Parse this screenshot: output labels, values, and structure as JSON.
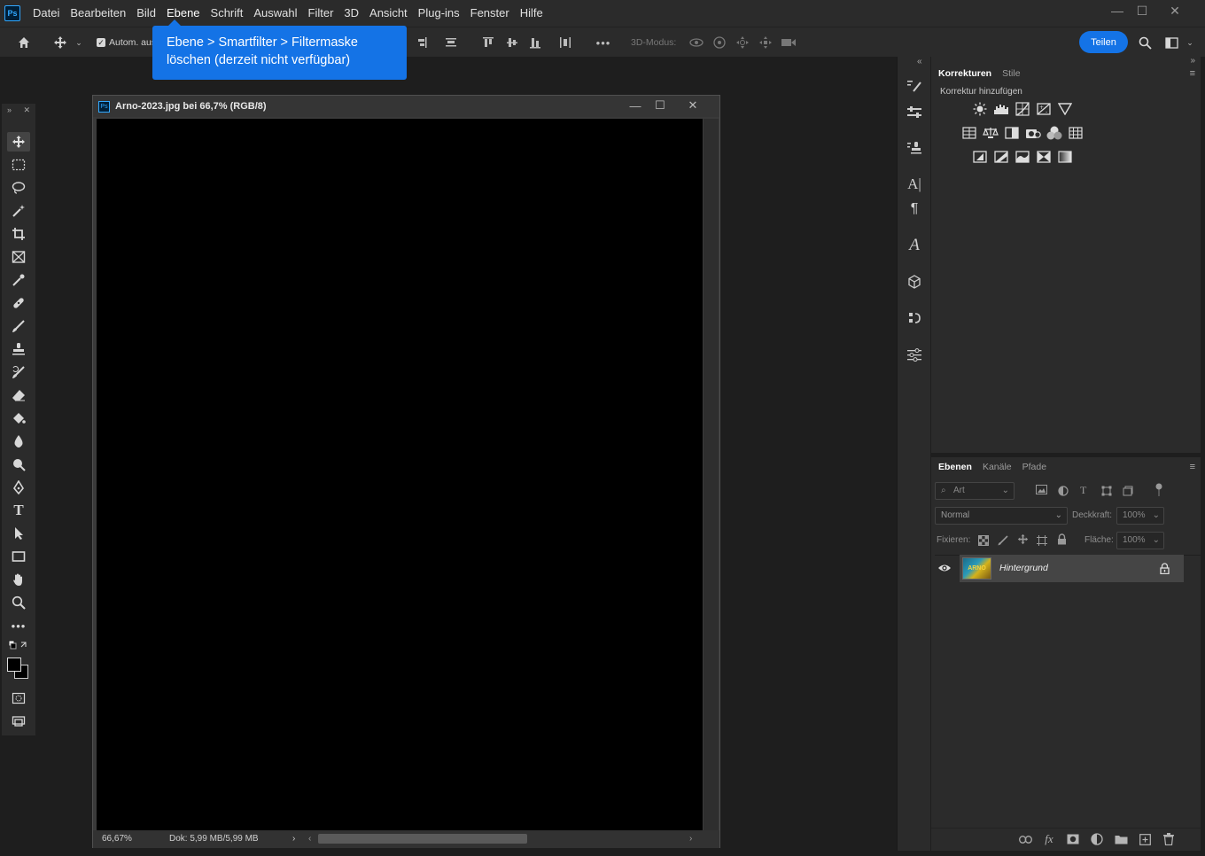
{
  "app": {
    "logo": "Ps",
    "menu": [
      "Datei",
      "Bearbeiten",
      "Bild",
      "Ebene",
      "Schrift",
      "Auswahl",
      "Filter",
      "3D",
      "Ansicht",
      "Plug-ins",
      "Fenster",
      "Hilfe"
    ],
    "window_controls": {
      "minimize": "—",
      "maximize": "☐",
      "close": "✕"
    }
  },
  "options_bar": {
    "auto_select_label": "Autom. aus",
    "mode_3d_label": "3D-Modus:",
    "more": "•••",
    "share_label": "Teilen"
  },
  "tooltip": {
    "line1": "Ebene > Smartfilter > Filtermaske",
    "line2": "löschen (derzeit nicht verfügbar)"
  },
  "document": {
    "title": "Arno-2023.jpg bei 66,7% (RGB/8)",
    "zoom": "66,67%",
    "doc_info": "Dok: 5,99 MB/5,99 MB",
    "ps_badge": "Ps"
  },
  "adjustments_panel": {
    "tabs": [
      "Korrekturen",
      "Stile"
    ],
    "heading": "Korrektur hinzufügen"
  },
  "layers_panel": {
    "tabs": [
      "Ebenen",
      "Kanäle",
      "Pfade"
    ],
    "filter_placeholder": "Art",
    "blend_mode": "Normal",
    "opacity_label": "Deckkraft:",
    "opacity_value": "100%",
    "lock_label": "Fixieren:",
    "fill_label": "Fläche:",
    "fill_value": "100%",
    "layers": [
      {
        "name": "Hintergrund",
        "visible": true,
        "locked": true,
        "thumb_text": "ARNO"
      }
    ]
  },
  "icons": {
    "home": "home-icon",
    "move": "move-icon",
    "search": "search-icon",
    "workspace": "workspace-icon"
  }
}
